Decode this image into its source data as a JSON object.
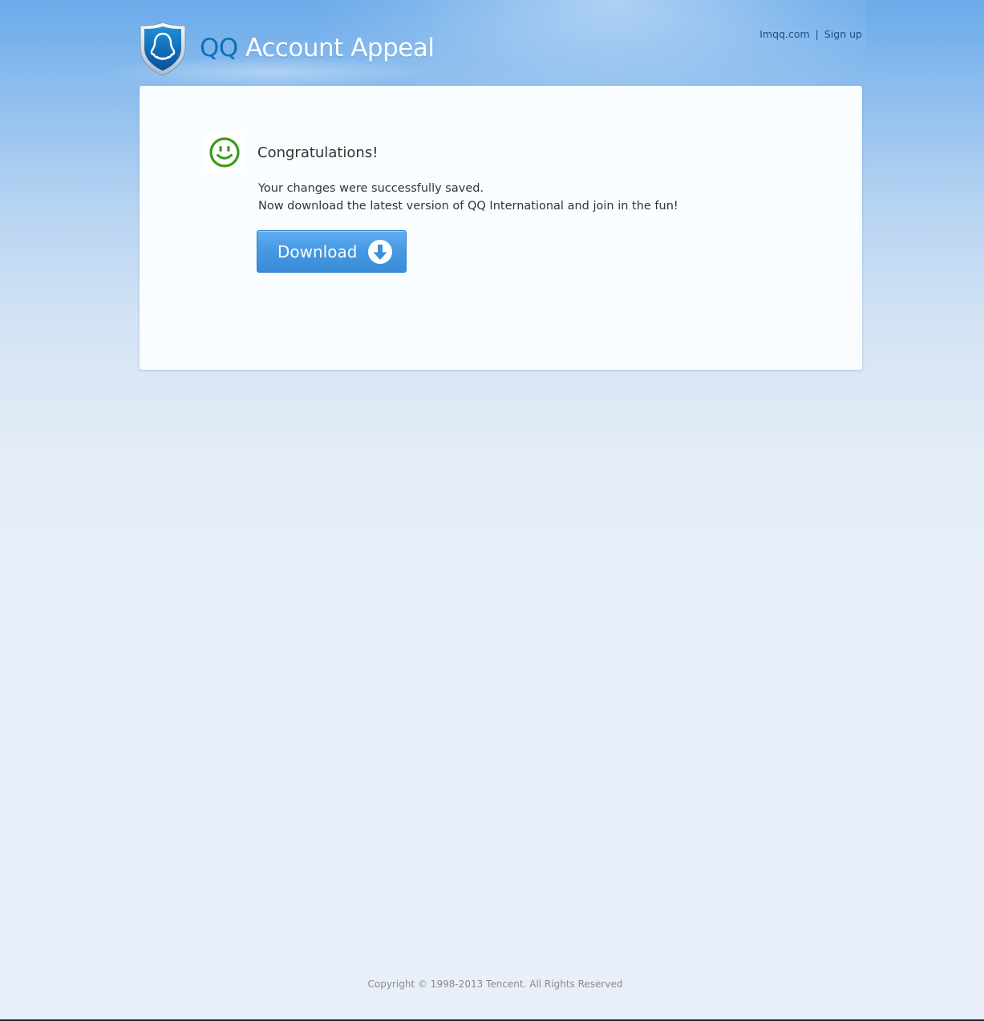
{
  "header": {
    "brand_qq": "QQ",
    "brand_rest": "Account Appeal",
    "logo_icon": "qq-penguin-shield-icon",
    "links": [
      {
        "label": "Imqq.com"
      },
      {
        "label": "Sign up"
      }
    ],
    "separator": "|"
  },
  "main": {
    "icon": "smiley-face-icon",
    "title": "Congratulations!",
    "message_line1": "Your changes were successfully saved.",
    "message_line2": "Now download the latest version of QQ International and join in the fun!",
    "download_label": "Download",
    "download_icon": "download-arrow-icon"
  },
  "footer": {
    "copyright": "Copyright © 1998-2013 Tencent. All Rights Reserved"
  },
  "colors": {
    "accent": "#0f6fb8",
    "button": "#4598e2",
    "smile": "#3d9a1c",
    "link": "#1a4f80"
  }
}
